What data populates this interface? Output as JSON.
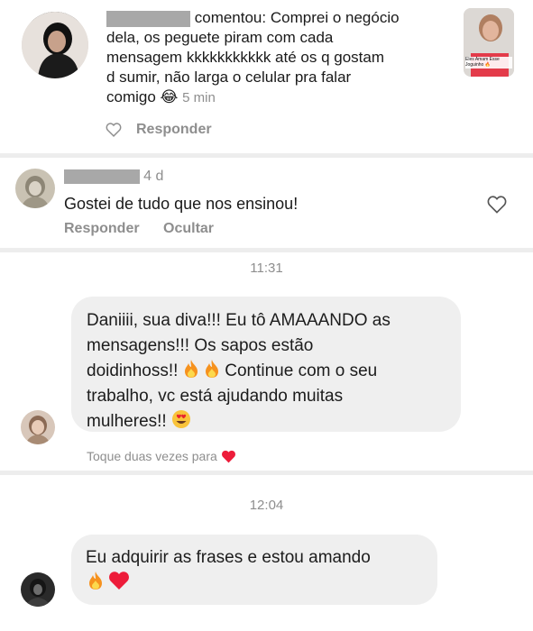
{
  "comment1": {
    "username": "",
    "action": "comentou:",
    "text_lines": [
      "Comprei o negócio",
      "dela,  os peguete piram com cada",
      "mensagem kkkkkkkkkkk até os q gostam",
      "d sumir,  não larga o celular pra falar",
      "comigo"
    ],
    "emoji": "😂",
    "time": "5 min",
    "reply_label": "Responder",
    "thumbnail_caption": "Eles Amam Esse Joguinho 🔥"
  },
  "comment2": {
    "username": "",
    "time": "4 d",
    "text": "Gostei de tudo que nos ensinou!",
    "reply_label": "Responder",
    "hide_label": "Ocultar"
  },
  "message1": {
    "timestamp": "11:31",
    "lines": [
      "Daniiii, sua diva!!! Eu tô AMAAANDO as",
      "mensagens!!! Os sapos estão",
      "doidinhoss!! 🔥🔥 Continue com o seu",
      "trabalho, vc está ajudando muitas",
      "mulheres!! 😍"
    ],
    "line3_prefix": "doidinhoss!!",
    "line3_suffix": "Continue com o seu",
    "line5_text": "mulheres!!",
    "line5_emoji": "😍",
    "double_tap_hint": "Toque duas vezes para"
  },
  "message2": {
    "timestamp": "12:04",
    "line1": "Eu adquirir as frases e estou amando"
  },
  "colors": {
    "red_heart": "#ed1c3a",
    "fire_orange": "#f6921e",
    "bubble_bg": "#efefef",
    "secondary_text": "#8e8e8e"
  }
}
